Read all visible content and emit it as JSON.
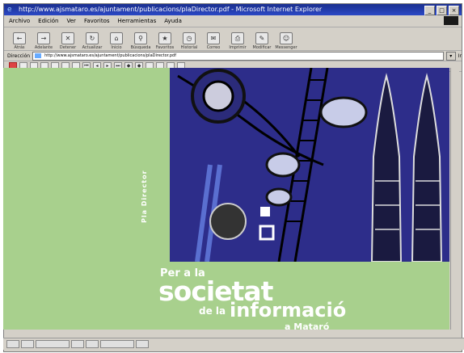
{
  "window": {
    "title": "http://www.ajsmataro.es/ajuntament/publicacions/plaDirector.pdf - Microsoft Internet Explorer",
    "controls": [
      "_",
      "□",
      "×"
    ]
  },
  "menu": [
    "Archivo",
    "Edición",
    "Ver",
    "Favoritos",
    "Herramientas",
    "Ayuda"
  ],
  "toolbar": {
    "buttons": [
      {
        "label": "Atrás",
        "icon": "back-arrow-icon",
        "glyph": "←"
      },
      {
        "label": "Adelante",
        "icon": "forward-arrow-icon",
        "glyph": "→"
      },
      {
        "label": "Detener",
        "icon": "stop-icon",
        "glyph": "✕"
      },
      {
        "label": "Actualizar",
        "icon": "refresh-icon",
        "glyph": "↻"
      },
      {
        "label": "Inicio",
        "icon": "home-icon",
        "glyph": "⌂"
      },
      {
        "label": "Búsqueda",
        "icon": "search-icon",
        "glyph": "⚲"
      },
      {
        "label": "Favoritos",
        "icon": "favorites-icon",
        "glyph": "★"
      },
      {
        "label": "Historial",
        "icon": "history-icon",
        "glyph": "◷"
      },
      {
        "label": "Correo",
        "icon": "mail-icon",
        "glyph": "✉"
      },
      {
        "label": "Imprimir",
        "icon": "print-icon",
        "glyph": "⎙"
      },
      {
        "label": "Modificar",
        "icon": "edit-icon",
        "glyph": "✎"
      },
      {
        "label": "Messenger",
        "icon": "messenger-icon",
        "glyph": "☺"
      }
    ]
  },
  "address": {
    "label": "Dirección",
    "value": "http://www.ajsmataro.es/ajuntament/publicacions/plaDirector.pdf",
    "go_label": "Ir"
  },
  "pdf_toolbar_icons": [
    "save-icon",
    "print-icon",
    "email-icon",
    "hand-icon",
    "select-icon",
    "zoom-icon",
    "first-page-icon",
    "prev-page-icon",
    "next-page-icon",
    "last-page-icon",
    "back-icon",
    "forward-icon",
    "single-page-icon",
    "continuous-icon",
    "fit-page-icon",
    "fit-width-icon",
    "find-icon"
  ],
  "document": {
    "vertical_label": "Pla Director",
    "line1": "Per a la",
    "line2": "societat",
    "line3a": "de la",
    "line3b": "informació",
    "line4": "a Mataró"
  },
  "colors": {
    "page_green": "#a8d08d",
    "art_blue": "#2d2d8a",
    "title_bar": "#1a2f8f"
  }
}
